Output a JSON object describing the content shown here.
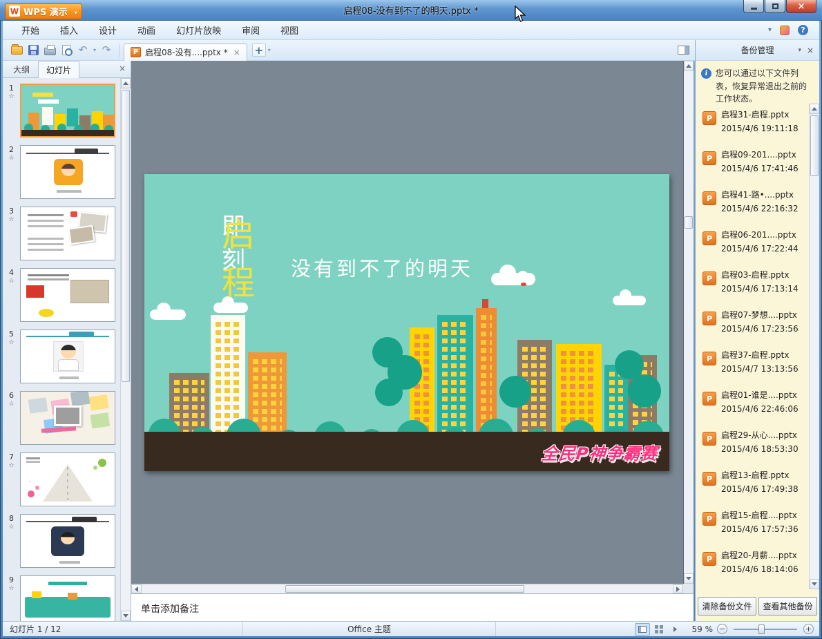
{
  "titlebar": {
    "app_button_label": "WPS 演示",
    "window_title": "启程08-没有到不了的明天.pptx *"
  },
  "menubar": {
    "tabs": [
      "开始",
      "插入",
      "设计",
      "动画",
      "幻灯片放映",
      "审阅",
      "视图"
    ]
  },
  "toolbar": {
    "document_tab_label": "启程08-没有....pptx *"
  },
  "sidebar": {
    "tabs": [
      "大纲",
      "幻灯片"
    ],
    "active_tab": "幻灯片",
    "slide_numbers": [
      "1",
      "2",
      "3",
      "4",
      "5",
      "6",
      "7",
      "8",
      "9"
    ]
  },
  "slide": {
    "title_prefix": "即刻",
    "title_emphasis": "启程",
    "subtitle": "没有到不了的明天",
    "badge": "全民P神争霸赛",
    "colors": {
      "sky": "#7ed2c1",
      "ground": "#392a20",
      "accent_yellow": "#f2e23c",
      "badge_pink": "#ff2e7e"
    }
  },
  "notes_placeholder": "单击添加备注",
  "backup_panel": {
    "title": "备份管理",
    "info_text": "您可以通过以下文件列表，恢复异常退出之前的工作状态。",
    "files": [
      {
        "name": "启程31-启程.pptx",
        "time": "2015/4/6 19:11:18"
      },
      {
        "name": "启程09-201....pptx",
        "time": "2015/4/6 17:41:46"
      },
      {
        "name": "启程41-路•....pptx",
        "time": "2015/4/6 22:16:32"
      },
      {
        "name": "启程06-201....pptx",
        "time": "2015/4/6 17:22:44"
      },
      {
        "name": "启程03-启程.pptx",
        "time": "2015/4/6 17:13:14"
      },
      {
        "name": "启程07-梦想....pptx",
        "time": "2015/4/6 17:23:56"
      },
      {
        "name": "启程37-启程.pptx",
        "time": "2015/4/7 13:13:56"
      },
      {
        "name": "启程01-谁是....pptx",
        "time": "2015/4/6 22:46:06"
      },
      {
        "name": "启程29-从心....pptx",
        "time": "2015/4/6 18:53:30"
      },
      {
        "name": "启程13-启程.pptx",
        "time": "2015/4/6 17:49:38"
      },
      {
        "name": "启程15-启程....pptx",
        "time": "2015/4/6 17:57:36"
      },
      {
        "name": "启程20-月薪....pptx",
        "time": "2015/4/6 18:14:06"
      }
    ],
    "clear_button": "清除备份文件",
    "view_button": "查看其他备份"
  },
  "statusbar": {
    "slide_indicator": "幻灯片 1 / 12",
    "theme_name": "Office 主题",
    "zoom_level": "59 %"
  },
  "icons": {
    "close": "×",
    "dropdown": "▾",
    "undo": "↶",
    "redo": "↷",
    "new_tab": "+",
    "help": "?",
    "info": "i",
    "star": "☆",
    "zoom_out": "−",
    "zoom_in": "+",
    "file_type": "P",
    "wps_logo": "W"
  }
}
